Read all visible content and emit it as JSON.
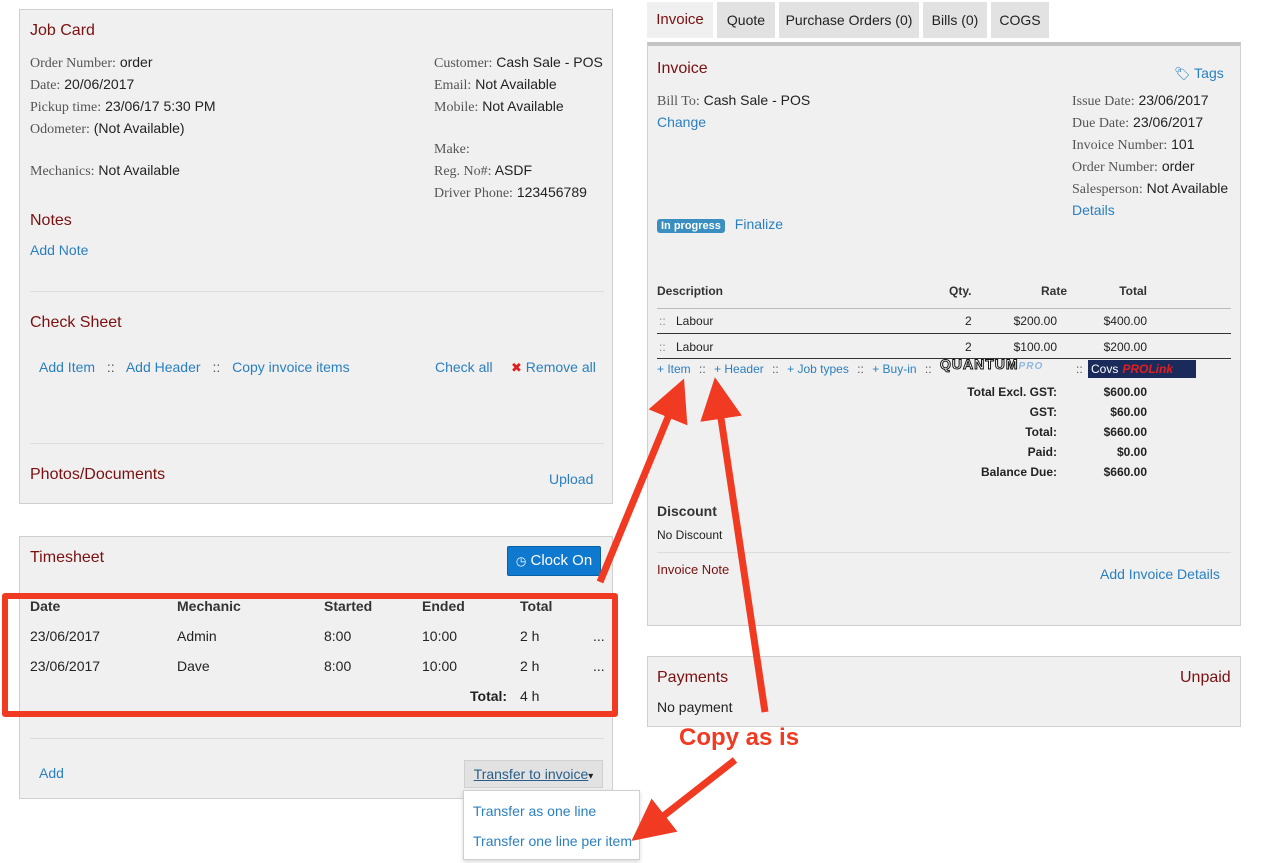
{
  "job_card": {
    "title": "Job Card",
    "order_number_label": "Order Number:",
    "order_number": "order",
    "date_label": "Date:",
    "date": "20/06/2017",
    "pickup_label": "Pickup time:",
    "pickup": "23/06/17 5:30 PM",
    "odometer_label": "Odometer:",
    "odometer": "(Not Available)",
    "mechanics_label": "Mechanics:",
    "mechanics": "Not Available",
    "customer_label": "Customer:",
    "customer": "Cash Sale - POS",
    "email_label": "Email:",
    "email": "Not Available",
    "mobile_label": "Mobile:",
    "mobile": "Not Available",
    "make_label": "Make:",
    "reg_label": "Reg. No#:",
    "reg": "ASDF",
    "driver_label": "Driver Phone:",
    "driver": "123456789",
    "notes_title": "Notes",
    "add_note": "Add Note",
    "check_sheet_title": "Check Sheet",
    "add_item": "Add Item",
    "add_header": "Add Header",
    "copy_invoice": "Copy invoice items",
    "check_all": "Check all",
    "remove_all": "Remove all",
    "remove_mark": "✖",
    "sep": "::",
    "photos_title": "Photos/Documents",
    "upload": "Upload"
  },
  "timesheet": {
    "title": "Timesheet",
    "clock_on": "Clock On",
    "clock_icon": "clock-icon",
    "headers": [
      "Date",
      "Mechanic",
      "Started",
      "Ended",
      "Total"
    ],
    "rows": [
      {
        "date": "23/06/2017",
        "mechanic": "Admin",
        "started": "8:00",
        "ended": "10:00",
        "total": "2 h",
        "more": "..."
      },
      {
        "date": "23/06/2017",
        "mechanic": "Dave",
        "started": "8:00",
        "ended": "10:00",
        "total": "2 h",
        "more": "..."
      }
    ],
    "total_label": "Total:",
    "total_value": "4 h",
    "add": "Add",
    "transfer": "Transfer to invoice",
    "transfer_caret": "▾",
    "dropdown_items": [
      "Transfer as one line",
      "Transfer one line per item"
    ]
  },
  "tabs": [
    "Invoice",
    "Quote",
    "Purchase Orders (0)",
    "Bills (0)",
    "COGS"
  ],
  "invoice": {
    "title": "Invoice",
    "tags": "Tags",
    "tag_icon": "tag-icon",
    "bill_to_label": "Bill To:",
    "bill_to": "Cash Sale - POS",
    "change": "Change",
    "issue_label": "Issue Date:",
    "issue": "23/06/2017",
    "due_label": "Due Date:",
    "due": "23/06/2017",
    "invoice_num_label": "Invoice Number:",
    "invoice_num": "101",
    "order_num_label": "Order Number:",
    "order_num": "order",
    "salesperson_label": "Salesperson:",
    "salesperson": "Not Available",
    "details": "Details",
    "status_badge": "In progress",
    "finalize": "Finalize",
    "columns": [
      "Description",
      "Qty.",
      "Rate",
      "Total"
    ],
    "lines": [
      {
        "handle": "::",
        "desc": "Labour",
        "qty": "2",
        "rate": "$200.00",
        "total": "$400.00"
      },
      {
        "handle": "::",
        "desc": "Labour",
        "qty": "2",
        "rate": "$100.00",
        "total": "$200.00"
      }
    ],
    "actions": [
      "+ Item",
      "+ Header",
      "+ Job types",
      "+ Buy-in"
    ],
    "sep": "::",
    "quantum": "QUANTUM",
    "quantum_pro": "PRO",
    "covs": "Covs",
    "prolink": "PROLink",
    "totals": [
      {
        "label": "Total Excl. GST:",
        "value": "$600.00"
      },
      {
        "label": "GST:",
        "value": "$60.00"
      },
      {
        "label": "Total:",
        "value": "$660.00"
      },
      {
        "label": "Paid:",
        "value": "$0.00"
      },
      {
        "label": "Balance Due:",
        "value": "$660.00"
      }
    ],
    "discount_title": "Discount",
    "discount_value": "No Discount",
    "invoice_note": "Invoice Note",
    "add_invoice_details": "Add Invoice Details"
  },
  "payments": {
    "title": "Payments",
    "status": "Unpaid",
    "value": "No payment"
  },
  "annotation": {
    "text": "Copy as is",
    "color": "#f03a22"
  },
  "colors": {
    "title_red": "#7a1010",
    "link_blue": "#2a7fc0",
    "button_blue": "#0f79d0",
    "badge_blue": "#3a8ec0"
  }
}
